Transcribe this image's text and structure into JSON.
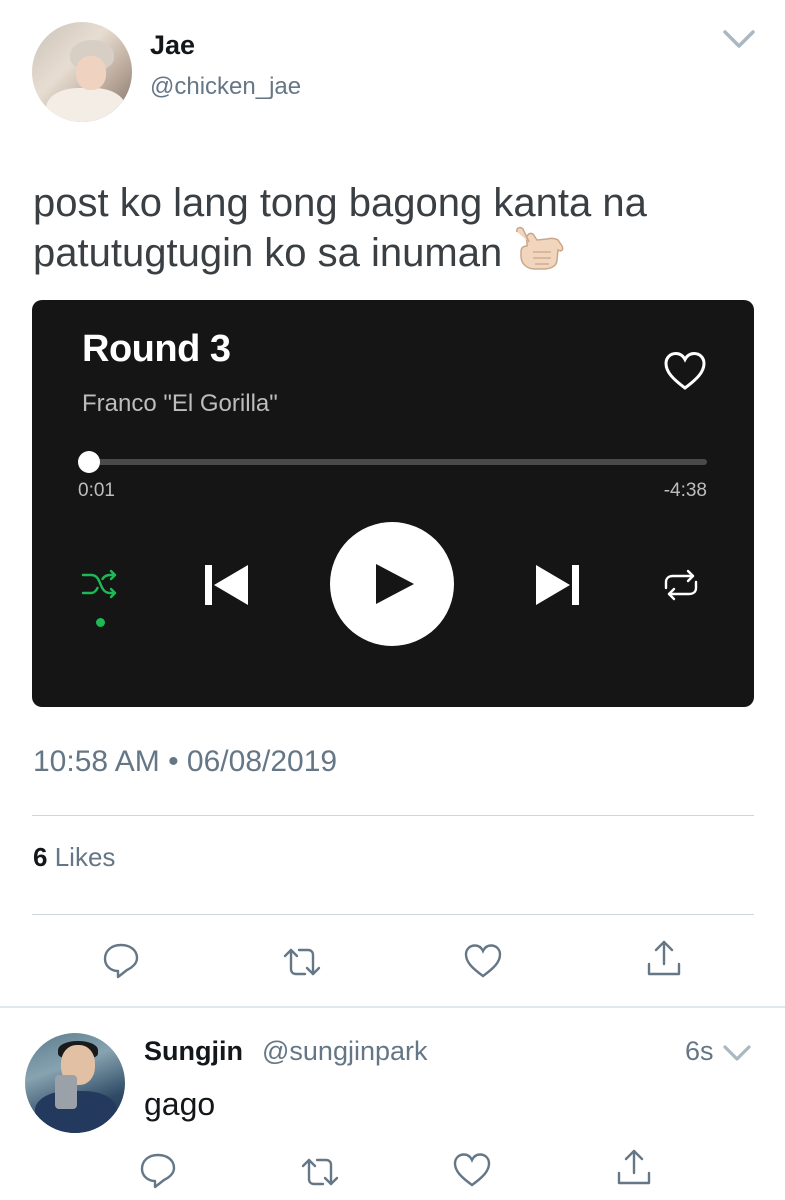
{
  "tweet": {
    "author_name": "Jae",
    "author_handle": "@chicken_jae",
    "text": "post ko lang tong bagong kanta na patutugtugin ko sa inuman",
    "emoji": "call-me-hand-emoji",
    "timestamp": "10:58 AM • 06/08/2019",
    "likes_count": "6",
    "likes_label": "Likes"
  },
  "player": {
    "song_title": "Round 3",
    "artist": "Franco \"El Gorilla\"",
    "elapsed": "0:01",
    "remaining": "-4:38",
    "progress_fraction": 0.004,
    "colors": {
      "background": "#151515",
      "accent": "#1db954",
      "text": "#ffffff"
    },
    "icons": [
      "heart-icon",
      "shuffle-icon",
      "previous-icon",
      "play-icon",
      "next-icon",
      "repeat-icon"
    ]
  },
  "actions": [
    "reply-icon",
    "retweet-icon",
    "like-icon",
    "share-icon"
  ],
  "reply": {
    "author_name": "Sungjin",
    "author_handle": "@sungjinpark",
    "time": "6s",
    "text": "gago"
  },
  "colors": {
    "secondary_text": "#657786",
    "divider": "#ccd6dd"
  }
}
